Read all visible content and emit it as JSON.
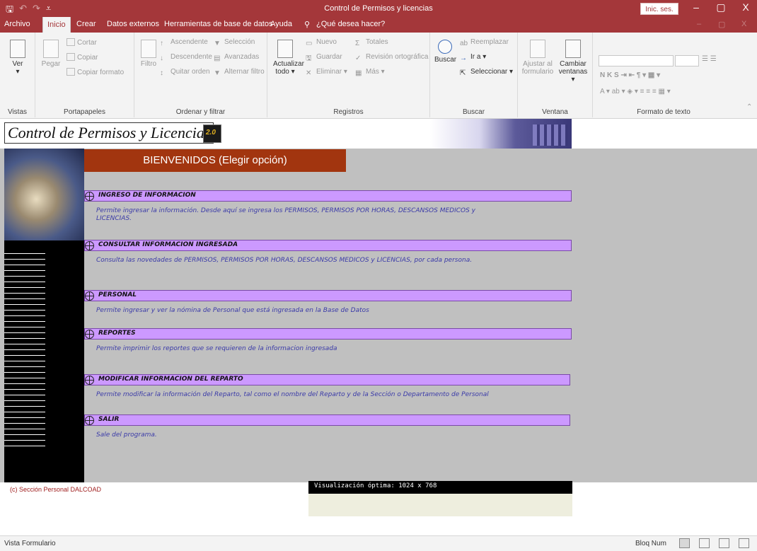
{
  "window": {
    "title": "Control de Permisos y licencias",
    "signin": "Inic. ses.",
    "minimize": "–",
    "restore": "▢",
    "close": "X"
  },
  "menu": {
    "items": [
      "Archivo",
      "Inicio",
      "Crear",
      "Datos externos",
      "Herramientas de base de datos",
      "Ayuda"
    ],
    "search": "¿Qué desea hacer?"
  },
  "ribbon": {
    "vistas": {
      "label": "Vistas",
      "ver": "Ver"
    },
    "portapapeles": {
      "label": "Portapapeles",
      "pegar": "Pegar",
      "cortar": "Cortar",
      "copiar": "Copiar",
      "copiar_formato": "Copiar formato"
    },
    "ordenar": {
      "label": "Ordenar y filtrar",
      "filtro": "Filtro",
      "ascendente": "Ascendente",
      "descendente": "Descendente",
      "quitar": "Quitar orden",
      "seleccion": "Selección",
      "avanzadas": "Avanzadas",
      "alternar": "Alternar filtro"
    },
    "registros": {
      "label": "Registros",
      "actualizar": "Actualizar",
      "actualizar2": "todo",
      "nuevo": "Nuevo",
      "guardar": "Guardar",
      "eliminar": "Eliminar",
      "totales": "Totales",
      "revision": "Revisión ortográfica",
      "mas": "Más"
    },
    "buscar": {
      "label": "Buscar",
      "buscar": "Buscar",
      "reemplazar": "Reemplazar",
      "ira": "Ir a",
      "seleccionar": "Seleccionar"
    },
    "ventana": {
      "label": "Ventana",
      "ajustar1": "Ajustar al",
      "ajustar2": "formulario",
      "cambiar1": "Cambiar",
      "cambiar2": "ventanas"
    },
    "formato": {
      "label": "Formato de texto"
    }
  },
  "form": {
    "header_title": "Control de Permisos y Licencias",
    "welcome": "BIENVENIDOS (Elegir opción)",
    "options": [
      {
        "label": "INGRESO DE INFORMACION",
        "desc": "Permite ingresar la información.  Desde aquí se ingresa los PERMISOS, PERMISOS POR HORAS, DESCANSOS MEDICOS y LICENCIAS."
      },
      {
        "label": "CONSULTAR INFORMACION INGRESADA",
        "desc": "Consulta las novedades de PERMISOS, PERMISOS POR HORAS, DESCANSOS MEDICOS y LICENCIAS, por cada persona."
      },
      {
        "label": "PERSONAL",
        "desc": "Permite ingresar y ver la nómina de Personal que está ingresada en la Base de Datos"
      },
      {
        "label": "REPORTES",
        "desc": "Permite imprimir los reportes que se requieren de la informacion ingresada"
      },
      {
        "label": "MODIFICAR INFORMACION DEL REPARTO",
        "desc": "Permite modificar la información del Reparto, tal como el nombre del Reparto y de la Sección o Departamento de Personal"
      },
      {
        "label": "SALIR",
        "desc": "Sale del programa."
      }
    ],
    "copyright": "(c) Sección Personal DALCOAD",
    "visualizacion": "Visualización óptima: 1024 x 768"
  },
  "statusbar": {
    "left": "Vista Formulario",
    "num": "Bloq Num"
  },
  "colors": {
    "titlebar": "#a4373a",
    "welcome_bg": "#a2350f",
    "option_bg": "#cc99ff",
    "desc_text": "#3a3aa8",
    "form_bg": "#c0c0c0"
  }
}
